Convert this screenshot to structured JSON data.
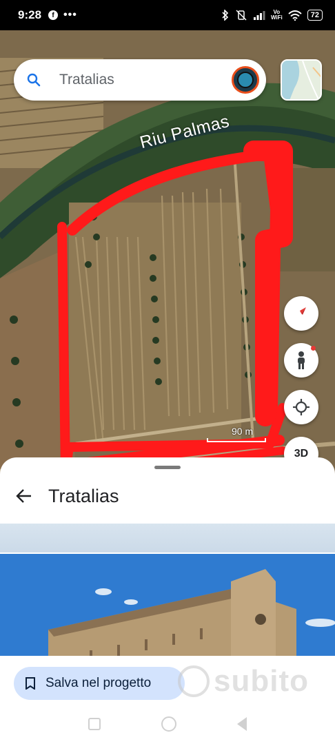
{
  "status_bar": {
    "time": "9:28",
    "app_icon": "facebook-icon",
    "more": "•••",
    "vowifi_top": "Vo",
    "vowifi_bottom": "WiFi",
    "battery": "72"
  },
  "search": {
    "query": "Tratalias"
  },
  "map": {
    "river_label": "Riu Palmas",
    "scale_label": "90 m",
    "annotation_color": "#ff1a1a",
    "buttons": {
      "compass": "compass-icon",
      "street_view": "pegman-icon",
      "my_location": "my-location-icon",
      "three_d": "3D"
    }
  },
  "sheet": {
    "title": "Tratalias",
    "save_label": "Salva nel progetto"
  },
  "watermark": {
    "text": "subito"
  },
  "colors": {
    "save_button_bg": "#d3e3fd",
    "search_bg": "#ffffff"
  }
}
